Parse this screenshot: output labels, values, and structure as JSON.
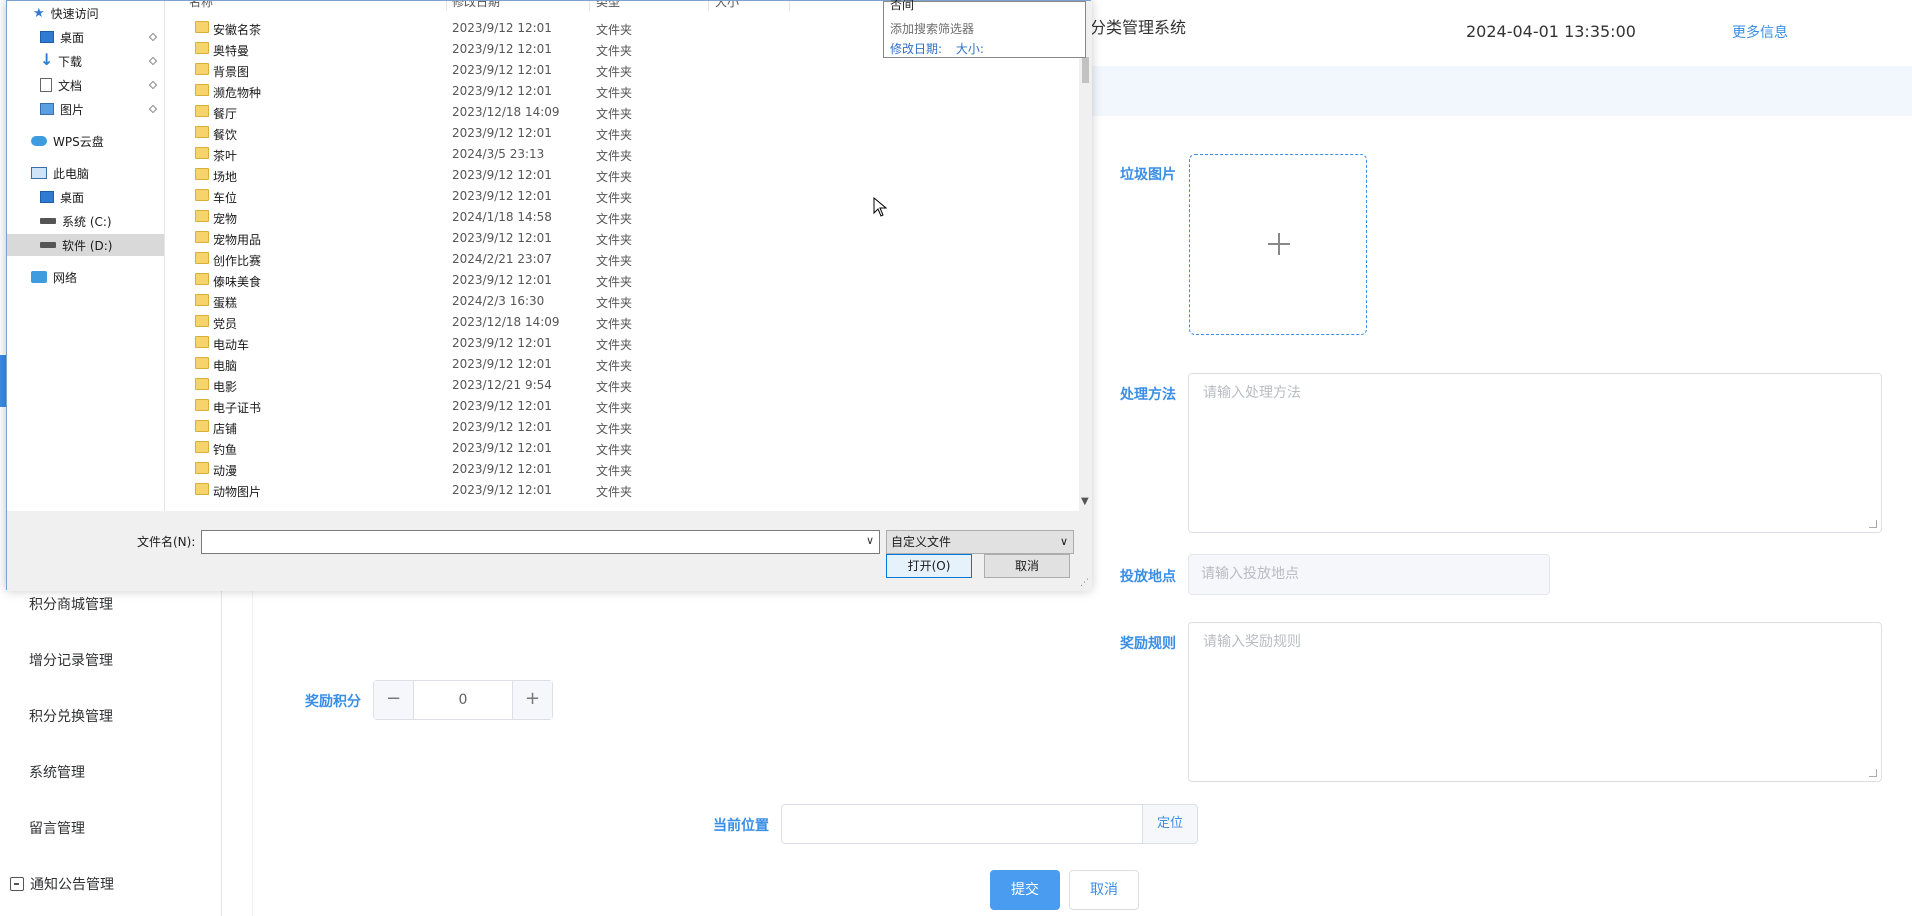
{
  "app": {
    "title": "分类管理系统",
    "datetime": "2024-04-01 13:35:00",
    "more_info": "更多信息",
    "menu": [
      "积分商城管理",
      "增分记录管理",
      "积分兑换管理",
      "系统管理",
      "留言管理",
      "通知公告管理"
    ]
  },
  "form": {
    "image_label": "垃圾图片",
    "method_label": "处理方法",
    "method_placeholder": "请输入处理方法",
    "location_label": "投放地点",
    "location_placeholder": "请输入投放地点",
    "rule_label": "奖励规则",
    "rule_placeholder": "请输入奖励规则",
    "points_label": "奖励积分",
    "points_value": "0",
    "minus": "−",
    "plus": "+",
    "position_label": "当前位置",
    "locate_button": "定位",
    "submit": "提交",
    "cancel": "取消"
  },
  "dialog": {
    "nav": {
      "quick_access": "快速访问",
      "desktop": "桌面",
      "downloads": "下载",
      "documents": "文档",
      "pictures": "图片",
      "wps_cloud": "WPS云盘",
      "this_pc": "此电脑",
      "pc_desktop": "桌面",
      "drive_c": "系统 (C:)",
      "drive_d": "软件 (D:)",
      "network": "网络"
    },
    "columns": {
      "name": "名称",
      "modified": "修改日期",
      "type": "类型",
      "size": "大小"
    },
    "search_popup": {
      "hint": "否间",
      "add_filter": "添加搜索筛选器",
      "modified": "修改日期:",
      "size": "大小:"
    },
    "files": [
      {
        "name": "安徽名茶",
        "date": "2023/9/12 12:01",
        "type": "文件夹"
      },
      {
        "name": "奥特曼",
        "date": "2023/9/12 12:01",
        "type": "文件夹"
      },
      {
        "name": "背景图",
        "date": "2023/9/12 12:01",
        "type": "文件夹"
      },
      {
        "name": "濒危物种",
        "date": "2023/9/12 12:01",
        "type": "文件夹"
      },
      {
        "name": "餐厅",
        "date": "2023/12/18 14:09",
        "type": "文件夹"
      },
      {
        "name": "餐饮",
        "date": "2023/9/12 12:01",
        "type": "文件夹"
      },
      {
        "name": "茶叶",
        "date": "2024/3/5 23:13",
        "type": "文件夹"
      },
      {
        "name": "场地",
        "date": "2023/9/12 12:01",
        "type": "文件夹"
      },
      {
        "name": "车位",
        "date": "2023/9/12 12:01",
        "type": "文件夹"
      },
      {
        "name": "宠物",
        "date": "2024/1/18 14:58",
        "type": "文件夹"
      },
      {
        "name": "宠物用品",
        "date": "2023/9/12 12:01",
        "type": "文件夹"
      },
      {
        "name": "创作比赛",
        "date": "2024/2/21 23:07",
        "type": "文件夹"
      },
      {
        "name": "傣味美食",
        "date": "2023/9/12 12:01",
        "type": "文件夹"
      },
      {
        "name": "蛋糕",
        "date": "2024/2/3 16:30",
        "type": "文件夹"
      },
      {
        "name": "党员",
        "date": "2023/12/18 14:09",
        "type": "文件夹"
      },
      {
        "name": "电动车",
        "date": "2023/9/12 12:01",
        "type": "文件夹"
      },
      {
        "name": "电脑",
        "date": "2023/9/12 12:01",
        "type": "文件夹"
      },
      {
        "name": "电影",
        "date": "2023/12/21 9:54",
        "type": "文件夹"
      },
      {
        "name": "电子证书",
        "date": "2023/9/12 12:01",
        "type": "文件夹"
      },
      {
        "name": "店铺",
        "date": "2023/9/12 12:01",
        "type": "文件夹"
      },
      {
        "name": "钓鱼",
        "date": "2023/9/12 12:01",
        "type": "文件夹"
      },
      {
        "name": "动漫",
        "date": "2023/9/12 12:01",
        "type": "文件夹"
      },
      {
        "name": "动物图片",
        "date": "2023/9/12 12:01",
        "type": "文件夹"
      }
    ],
    "filename_label": "文件名(N):",
    "filetype": "自定义文件",
    "open_button": "打开(O)",
    "cancel_button": "取消"
  }
}
